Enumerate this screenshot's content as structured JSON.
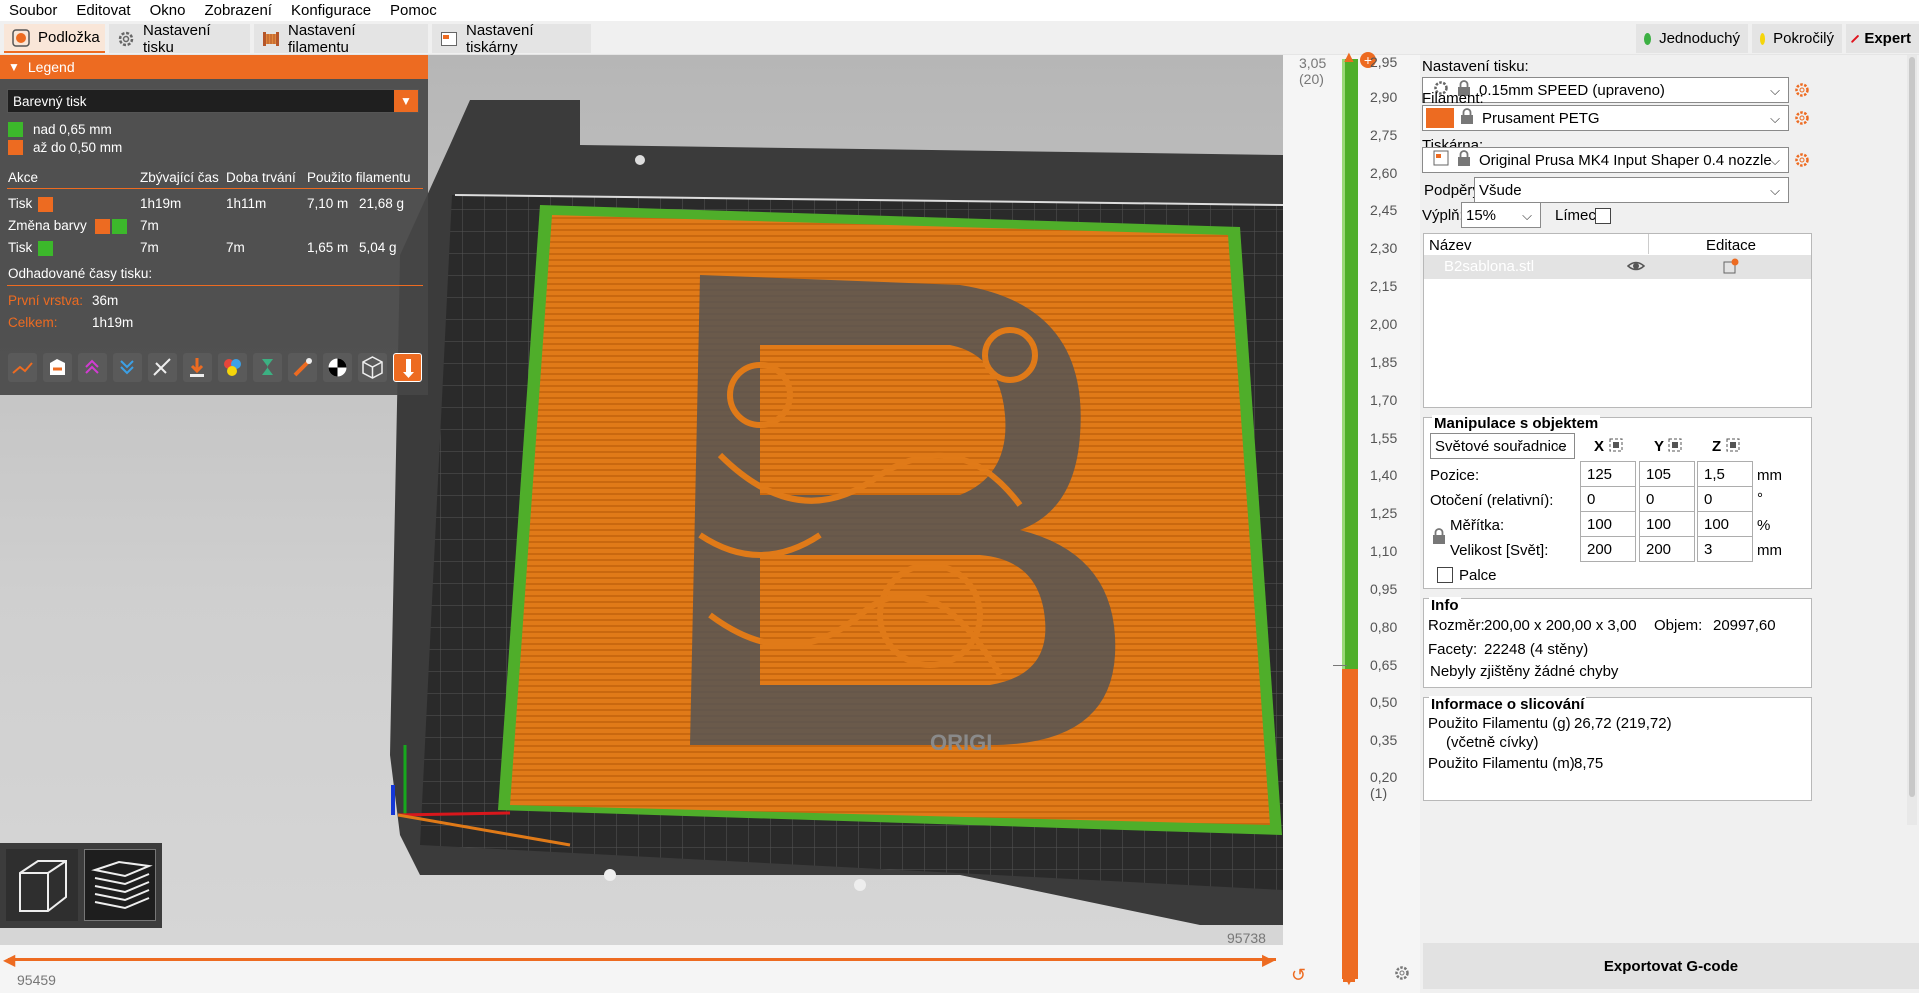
{
  "menu": [
    "Soubor",
    "Editovat",
    "Okno",
    "Zobrazení",
    "Konfigurace",
    "Pomoc"
  ],
  "tabs": [
    {
      "label": "Podložka",
      "active": true
    },
    {
      "label": "Nastavení tisku",
      "active": false
    },
    {
      "label": "Nastavení filamentu",
      "active": false
    },
    {
      "label": "Nastavení tiskárny",
      "active": false
    }
  ],
  "modes": [
    {
      "label": "Jednoduchý",
      "color": "#3cb043"
    },
    {
      "label": "Pokročilý",
      "color": "#f5d50a"
    },
    {
      "label": "Expert",
      "color": "#e0141e",
      "bold": true
    }
  ],
  "legend": {
    "title": "Legend",
    "view_type": "Barevný tisk",
    "entries": [
      {
        "label": "nad 0,65 mm",
        "color": "#3cb82b"
      },
      {
        "label": "až do 0,50 mm",
        "color": "#ed6b21"
      }
    ],
    "headers": [
      "Akce",
      "Zbývající čas",
      "Doba trvání",
      "Použito filamentu"
    ],
    "rows": [
      {
        "action": "Tisk",
        "remaining": "1h19m",
        "duration": "1h11m",
        "length": "7,10 m",
        "weight": "21,68 g"
      },
      {
        "action": "Změna barvy",
        "remaining": "7m",
        "duration": "",
        "length": "",
        "weight": ""
      },
      {
        "action": "Tisk",
        "remaining": "7m",
        "duration": "7m",
        "length": "1,65 m",
        "weight": "5,04 g"
      }
    ],
    "estimated_label": "Odhadované časy tisku:",
    "first_layer_label": "První vrstva:",
    "first_layer_value": "36m",
    "total_label": "Celkem:",
    "total_value": "1h19m"
  },
  "model_text": "ORIGI",
  "hslider": {
    "left_value": "95459",
    "right_value": "95738"
  },
  "vslider": {
    "top_value": "3,05",
    "top_layer": "(20)",
    "ticks": [
      "2,95",
      "2,90",
      "2,75",
      "2,60",
      "2,45",
      "2,30",
      "2,15",
      "2,00",
      "1,85",
      "1,70",
      "1,55",
      "1,40",
      "1,25",
      "1,10",
      "0,95",
      "0,80",
      "0,65",
      "0,50",
      "0,35",
      "0,20"
    ],
    "bottom_layer": "(1)",
    "color_change_at": 0.65
  },
  "right": {
    "print_label": "Nastavení tisku:",
    "print_value": "0.15mm SPEED (upraveno)",
    "filament_label": "Filament:",
    "filament_value": "Prusament PETG",
    "filament_color": "#ed6b21",
    "printer_label": "Tiskárna:",
    "printer_value": "Original Prusa MK4 Input Shaper 0.4 nozzle",
    "supports_label": "Podpěry:",
    "supports_value": "Všude",
    "infill_label": "Výplň:",
    "infill_value": "15%",
    "brim_label": "Límec:",
    "list_name_header": "Název",
    "list_edit_header": "Editace",
    "object_name": "B2sablona.stl",
    "manip_title": "Manipulace s objektem",
    "coords_value": "Světové souřadnice",
    "axes": [
      "X",
      "Y",
      "Z"
    ],
    "position_label": "Pozice:",
    "position": [
      "125",
      "105",
      "1,5"
    ],
    "position_unit": "mm",
    "rotation_label": "Otočení (relativní):",
    "rotation": [
      "0",
      "0",
      "0"
    ],
    "rotation_unit": "°",
    "scale_label": "Měřítka:",
    "scale": [
      "100",
      "100",
      "100"
    ],
    "scale_unit": "%",
    "size_label": "Velikost [Svět]:",
    "size": [
      "200",
      "200",
      "3"
    ],
    "size_unit": "mm",
    "inches_label": "Palce",
    "info_title": "Info",
    "size_info_label": "Rozměr:",
    "size_info_value": "200,00 x 200,00 x 3,00",
    "volume_label": "Objem:",
    "volume_value": "20997,60",
    "facets_label": "Facety:",
    "facets_value": "22248 (4 stěny)",
    "errors_text": "Nebyly zjištěny žádné chyby",
    "slice_title": "Informace o slicování",
    "used_g_label": "Použito Filamentu (g)",
    "used_g_sub": "(včetně cívky)",
    "used_g_value": "26,72 (219,72)",
    "used_m_label": "Použito Filamentu (m)",
    "used_m_value": "8,75",
    "export_label": "Exportovat G-code"
  }
}
